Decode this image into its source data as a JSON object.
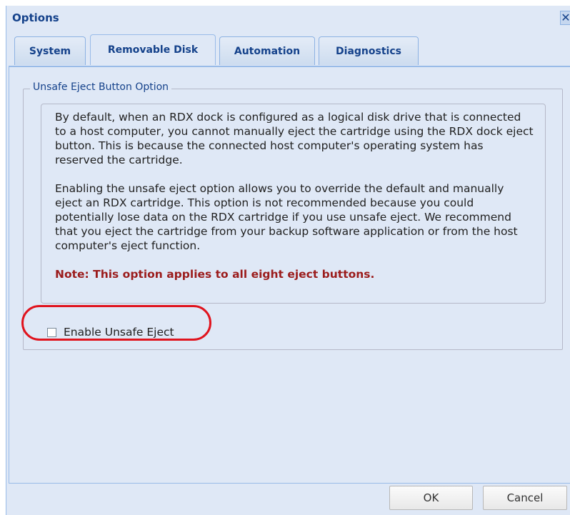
{
  "window": {
    "title": "Options",
    "close_glyph": "✕"
  },
  "tabs": [
    {
      "label": "System",
      "active": false
    },
    {
      "label": "Removable Disk",
      "active": true
    },
    {
      "label": "Automation",
      "active": false
    },
    {
      "label": "Diagnostics",
      "active": false
    }
  ],
  "fieldset": {
    "legend": "Unsafe Eject Button Option",
    "paragraphs": [
      "By default, when an RDX dock is configured as a logical disk drive that is connected to a host computer, you cannot manually eject the cartridge using the RDX dock eject button. This is because the connected host computer's operating system has reserved the cartridge.",
      "Enabling the unsafe eject option allows you to override the default and manually eject an RDX cartridge. This option is not recommended because you could potentially lose data on the RDX cartridge if you use unsafe eject. We recommend that you eject the cartridge from your backup software application or from the host computer's eject function."
    ],
    "note": "Note: This option applies to all eight eject buttons."
  },
  "checkbox": {
    "label": "Enable Unsafe Eject",
    "checked": false
  },
  "footer": {
    "ok_label": "OK",
    "cancel_label": "Cancel"
  },
  "colors": {
    "header_text": "#15428b",
    "panel_bg": "#dfe8f6",
    "note_text": "#9b1c1c",
    "highlight": "#e0141e"
  }
}
